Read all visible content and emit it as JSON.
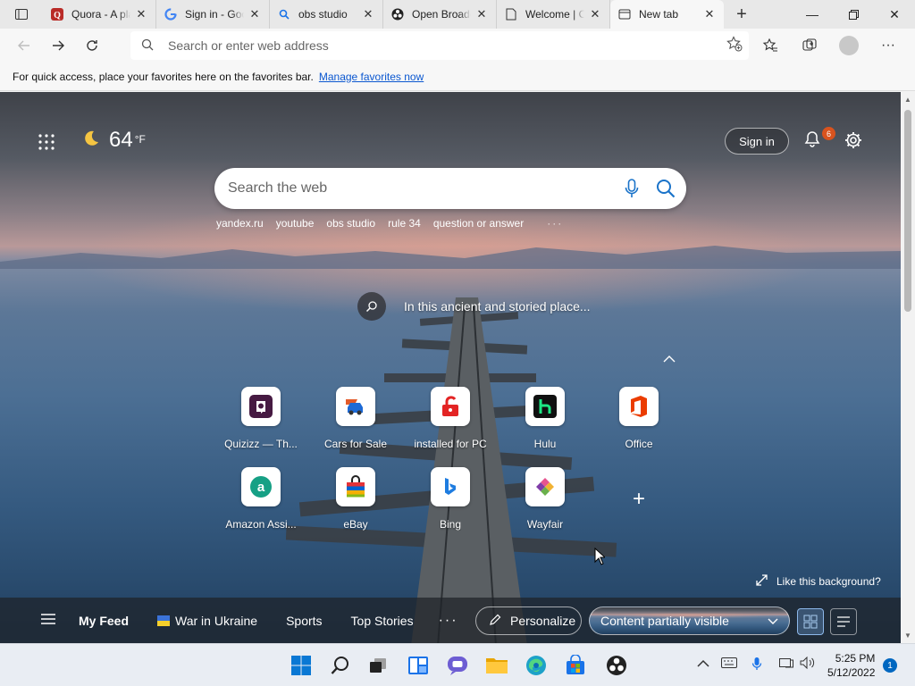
{
  "tabs": [
    {
      "title": "Quora - A place to share",
      "icon": "quora-icon",
      "active": false
    },
    {
      "title": "Sign in - Google Accounts",
      "icon": "google-icon",
      "active": false
    },
    {
      "title": "obs studio",
      "icon": "search-icon",
      "active": false
    },
    {
      "title": "Open Broadcaster Software",
      "icon": "obs-icon",
      "active": false
    },
    {
      "title": "Welcome | OBS",
      "icon": "page-icon",
      "active": false
    },
    {
      "title": "New tab",
      "icon": "newtab-icon",
      "active": true
    }
  ],
  "toolbar": {
    "address_placeholder": "Search or enter web address"
  },
  "favbar": {
    "text": "For quick access, place your favorites here on the favorites bar.",
    "link": "Manage favorites now"
  },
  "weather": {
    "temp": "64",
    "unit": "°F"
  },
  "header": {
    "signin": "Sign in",
    "notifications": "6"
  },
  "search": {
    "placeholder": "Search the web"
  },
  "quicklinks": [
    "yandex.ru",
    "youtube",
    "obs studio",
    "rule 34",
    "question or answer"
  ],
  "caption": "In this ancient and storied place...",
  "tiles": [
    {
      "label": "Quizizz — Th...",
      "icon": "quizizz-icon"
    },
    {
      "label": "Cars for Sale",
      "icon": "cars-icon"
    },
    {
      "label": "installed for PC",
      "icon": "lock-icon"
    },
    {
      "label": "Hulu",
      "icon": "hulu-icon"
    },
    {
      "label": "Office",
      "icon": "office-icon"
    },
    {
      "label": "Amazon Assi...",
      "icon": "amazon-icon"
    },
    {
      "label": "eBay",
      "icon": "ebay-icon"
    },
    {
      "label": "Bing",
      "icon": "bing-icon"
    },
    {
      "label": "Wayfair",
      "icon": "wayfair-icon"
    }
  ],
  "likebg": "Like this background?",
  "feed": {
    "myfeed": "My Feed",
    "ukraine": "War in Ukraine",
    "sports": "Sports",
    "topstories": "Top Stories",
    "personalize": "Personalize",
    "content": "Content partially visible"
  },
  "clock": {
    "time": "5:25 PM",
    "date": "5/12/2022",
    "notifications": "1"
  },
  "colors": {
    "accent": "#0067c0",
    "badge": "#d9531e"
  }
}
